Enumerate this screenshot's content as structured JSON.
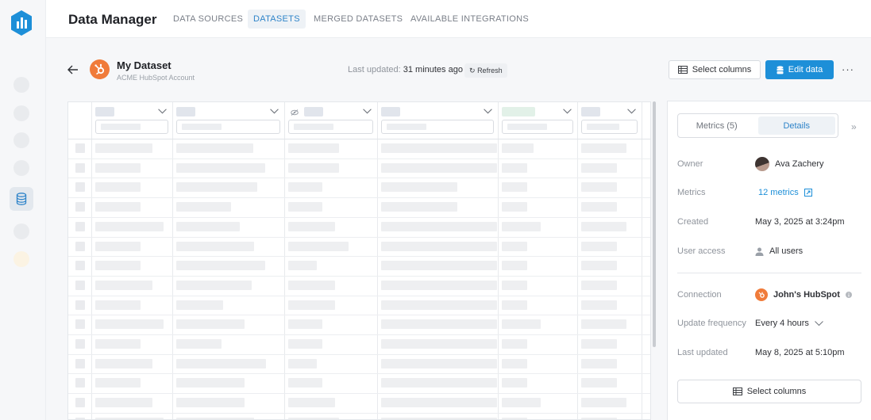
{
  "app": {
    "title": "Data Manager",
    "tabs": [
      {
        "label": "DATA SOURCES",
        "active": false
      },
      {
        "label": "DATASETS",
        "active": true
      },
      {
        "label": "MERGED DATASETS",
        "active": false
      },
      {
        "label": "AVAILABLE INTEGRATIONS",
        "active": false
      }
    ]
  },
  "dataset": {
    "name": "My Dataset",
    "account": "ACME HubSpot Account",
    "last_updated_label": "Last updated:",
    "last_updated_value": "31 minutes ago",
    "refresh_label": "Refresh"
  },
  "toolbar": {
    "select_columns_label": "Select columns",
    "edit_data_label": "Edit data",
    "more_label": "···"
  },
  "panel": {
    "tabs": [
      {
        "label": "Metrics (5)",
        "active": false
      },
      {
        "label": "Details",
        "active": true
      }
    ],
    "details": {
      "owner": {
        "label": "Owner",
        "value": "Ava Zachery"
      },
      "metrics": {
        "label": "Metrics",
        "value": "12 metrics"
      },
      "created": {
        "label": "Created",
        "value": "May 3, 2025 at 3:24pm"
      },
      "user_access": {
        "label": "User access",
        "value": "All users"
      },
      "connection": {
        "label": "Connection",
        "value": "John's HubSpot"
      },
      "update_frequency": {
        "label": "Update frequency",
        "value": "Every 4 hours"
      },
      "last_updated": {
        "label": "Last updated",
        "value": "May 8, 2025 at 5:10pm"
      }
    },
    "select_columns_label": "Select columns"
  },
  "colors": {
    "accent": "#1d8fd8",
    "hubspot": "#f07b3a",
    "logo": "#1d8fd8"
  }
}
